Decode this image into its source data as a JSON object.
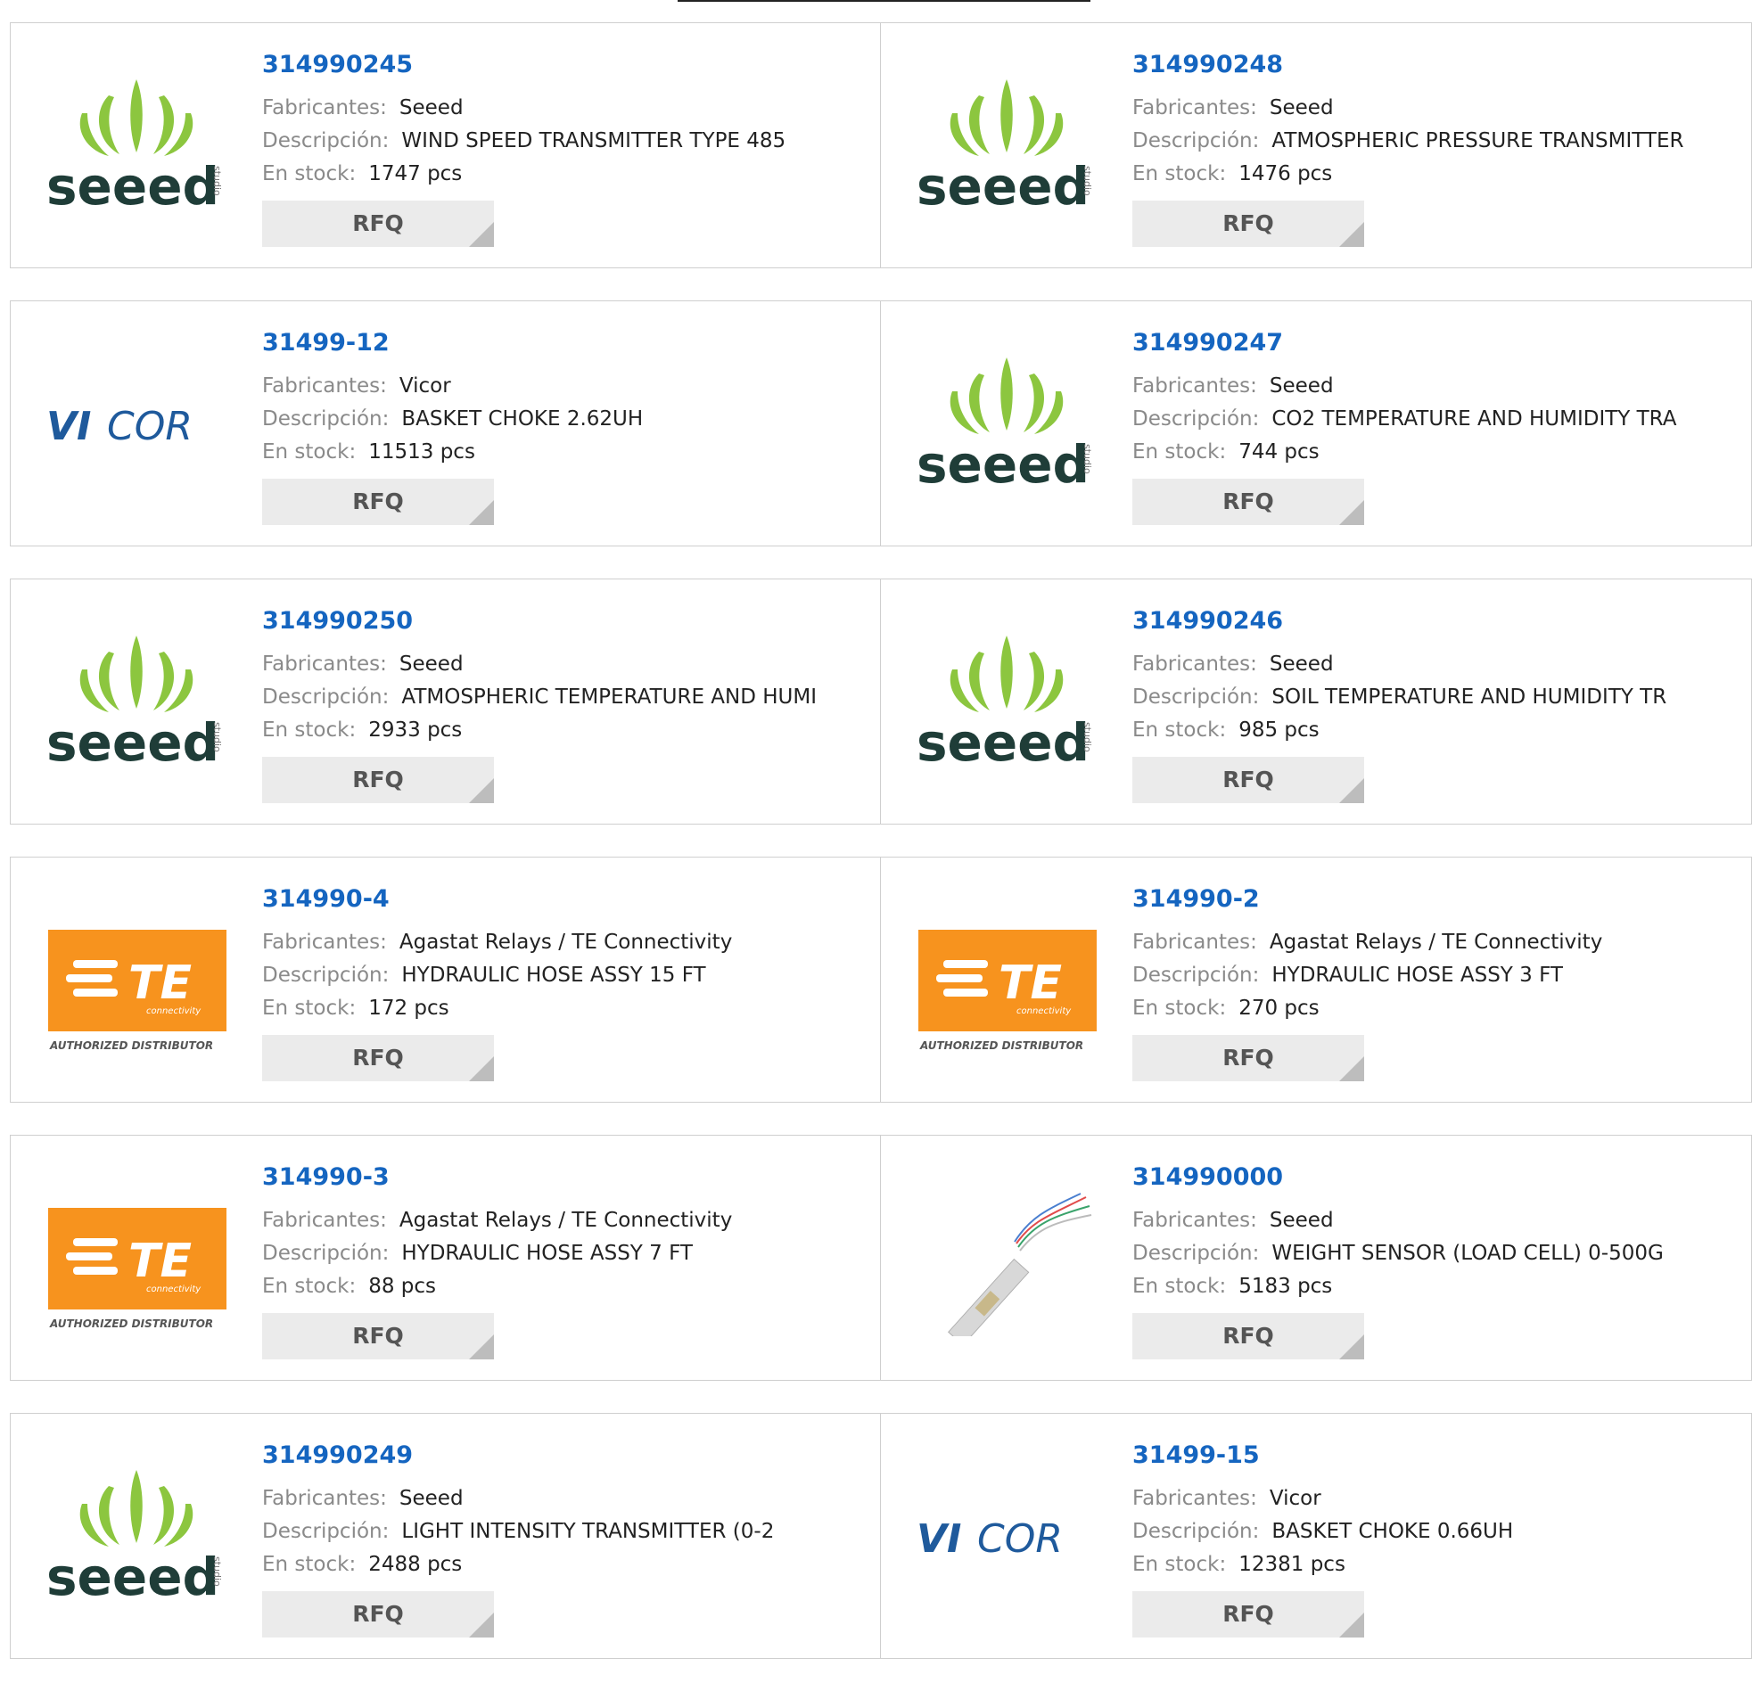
{
  "labels": {
    "manufacturer": "Fabricantes:",
    "description": "Descripción:",
    "stock": "En stock:",
    "rfq": "RFQ"
  },
  "brand_colors": {
    "seeed_green": "#8cc63f",
    "seeed_text": "#1f3d38",
    "vicor_blue": "#1f5a9c",
    "te_orange": "#f7931e",
    "part_link": "#1565c0"
  },
  "products": [
    {
      "part": "314990245",
      "manufacturer": "Seeed",
      "description": "WIND SPEED TRANSMITTER TYPE 485",
      "stock": "1747 pcs",
      "logo": "seeed"
    },
    {
      "part": "314990248",
      "manufacturer": "Seeed",
      "description": "ATMOSPHERIC PRESSURE TRANSMITTER",
      "stock": "1476 pcs",
      "logo": "seeed"
    },
    {
      "part": "31499-12",
      "manufacturer": "Vicor",
      "description": "BASKET CHOKE 2.62UH",
      "stock": "11513 pcs",
      "logo": "vicor"
    },
    {
      "part": "314990247",
      "manufacturer": "Seeed",
      "description": "CO2 TEMPERATURE AND HUMIDITY TRA",
      "stock": "744 pcs",
      "logo": "seeed"
    },
    {
      "part": "314990250",
      "manufacturer": "Seeed",
      "description": "ATMOSPHERIC TEMPERATURE AND HUMI",
      "stock": "2933 pcs",
      "logo": "seeed"
    },
    {
      "part": "314990246",
      "manufacturer": "Seeed",
      "description": "SOIL TEMPERATURE AND HUMIDITY TR",
      "stock": "985 pcs",
      "logo": "seeed"
    },
    {
      "part": "314990-4",
      "manufacturer": "Agastat Relays / TE Connectivity",
      "description": "HYDRAULIC HOSE ASSY 15 FT",
      "stock": "172 pcs",
      "logo": "te"
    },
    {
      "part": "314990-2",
      "manufacturer": "Agastat Relays / TE Connectivity",
      "description": "HYDRAULIC HOSE ASSY 3 FT",
      "stock": "270 pcs",
      "logo": "te"
    },
    {
      "part": "314990-3",
      "manufacturer": "Agastat Relays / TE Connectivity",
      "description": "HYDRAULIC HOSE ASSY 7 FT",
      "stock": "88 pcs",
      "logo": "te"
    },
    {
      "part": "314990000",
      "manufacturer": "Seeed",
      "description": "WEIGHT SENSOR (LOAD CELL) 0-500G",
      "stock": "5183 pcs",
      "logo": "load-cell-photo"
    },
    {
      "part": "314990249",
      "manufacturer": "Seeed",
      "description": "LIGHT INTENSITY TRANSMITTER (0-2",
      "stock": "2488 pcs",
      "logo": "seeed"
    },
    {
      "part": "31499-15",
      "manufacturer": "Vicor",
      "description": "BASKET CHOKE 0.66UH",
      "stock": "12381 pcs",
      "logo": "vicor"
    }
  ],
  "logo_text": {
    "seeed": "seeed",
    "seeed_small": "studio",
    "vicor": "VICOR",
    "te": "TE",
    "te_sub": "connectivity",
    "te_tag": "AUTHORIZED DISTRIBUTOR"
  }
}
